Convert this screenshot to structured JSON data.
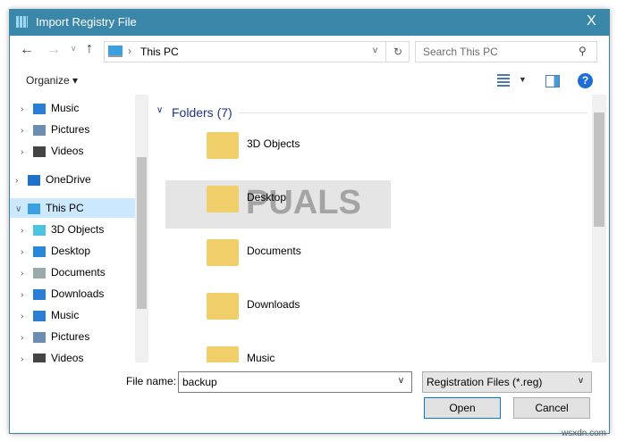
{
  "window": {
    "title": "Import Registry File",
    "close": "X"
  },
  "nav": {
    "path": "This PC",
    "search_placeholder": "Search This PC"
  },
  "toolbar": {
    "organize": "Organize ▾"
  },
  "sidebar": {
    "items": [
      {
        "label": "Music",
        "icon": "music-icon",
        "indent": 1
      },
      {
        "label": "Pictures",
        "icon": "pictures-icon",
        "indent": 1
      },
      {
        "label": "Videos",
        "icon": "videos-icon",
        "indent": 1
      },
      {
        "label": "OneDrive",
        "icon": "cloud-icon",
        "indent": 0
      },
      {
        "label": "This PC",
        "icon": "pc-icon",
        "indent": 0,
        "selected": true
      },
      {
        "label": "3D Objects",
        "icon": "cube-icon",
        "indent": 1
      },
      {
        "label": "Desktop",
        "icon": "desktop-icon",
        "indent": 1
      },
      {
        "label": "Documents",
        "icon": "documents-icon",
        "indent": 1
      },
      {
        "label": "Downloads",
        "icon": "downloads-icon",
        "indent": 1
      },
      {
        "label": "Music",
        "icon": "music-icon",
        "indent": 1
      },
      {
        "label": "Pictures",
        "icon": "pictures-icon",
        "indent": 1
      },
      {
        "label": "Videos",
        "icon": "videos-icon",
        "indent": 1
      }
    ]
  },
  "main": {
    "group_header": "Folders (7)",
    "folders": [
      "3D Objects",
      "Desktop",
      "Documents",
      "Downloads",
      "Music"
    ]
  },
  "footer": {
    "filename_label": "File name:",
    "filename_value": "backup",
    "filetype": "Registration Files (*.reg)",
    "open": "Open",
    "cancel": "Cancel"
  },
  "watermark": "A PUALS",
  "credit": "wsxdn.com"
}
